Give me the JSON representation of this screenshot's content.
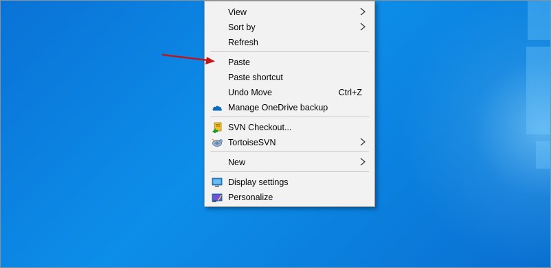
{
  "menu": {
    "items": [
      {
        "label": "View",
        "shortcut": "",
        "submenu": true
      },
      {
        "label": "Sort by",
        "shortcut": "",
        "submenu": true
      },
      {
        "label": "Refresh",
        "shortcut": "",
        "submenu": false
      },
      {
        "label": "Paste",
        "shortcut": "",
        "submenu": false
      },
      {
        "label": "Paste shortcut",
        "shortcut": "",
        "submenu": false
      },
      {
        "label": "Undo Move",
        "shortcut": "Ctrl+Z",
        "submenu": false
      },
      {
        "label": "Manage OneDrive backup",
        "shortcut": "",
        "submenu": false,
        "icon": "onedrive-cloud-icon"
      },
      {
        "label": "SVN Checkout...",
        "shortcut": "",
        "submenu": false,
        "icon": "svn-checkout-icon"
      },
      {
        "label": "TortoiseSVN",
        "shortcut": "",
        "submenu": true,
        "icon": "tortoisesvn-icon"
      },
      {
        "label": "New",
        "shortcut": "",
        "submenu": true
      },
      {
        "label": "Display settings",
        "shortcut": "",
        "submenu": false,
        "icon": "display-settings-icon"
      },
      {
        "label": "Personalize",
        "shortcut": "",
        "submenu": false,
        "icon": "personalize-icon"
      }
    ]
  },
  "colors": {
    "desktop_accent": "#0a72d6",
    "menu_background": "#f2f2f2",
    "annotation_arrow": "#c0151b"
  }
}
